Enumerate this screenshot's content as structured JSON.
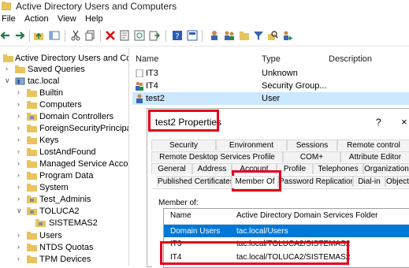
{
  "window": {
    "title": "Active Directory Users and Computers"
  },
  "menu": {
    "file": "File",
    "action": "Action",
    "view": "View",
    "help": "Help"
  },
  "tree": {
    "root": "Active Directory Users and Com",
    "saved_queries": "Saved Queries",
    "domain": "tac.local",
    "items": [
      "Builtin",
      "Computers",
      "Domain Controllers",
      "ForeignSecurityPrincipals",
      "Keys",
      "LostAndFound",
      "Managed Service Accour",
      "Program Data",
      "System",
      "Test_Adminis",
      "TOLUCA2"
    ],
    "sub_item": "SISTEMAS2",
    "after": [
      "Users",
      "NTDS Quotas",
      "TPM Devices"
    ]
  },
  "list": {
    "headers": {
      "name": "Name",
      "type": "Type",
      "description": "Description"
    },
    "rows": [
      {
        "name": "IT3",
        "type": "Unknown"
      },
      {
        "name": "IT4",
        "type": "Security Group..."
      },
      {
        "name": "test2",
        "type": "User"
      }
    ]
  },
  "dialog": {
    "title": "test2 Properties",
    "help": "?",
    "close": "×",
    "tabs_row1": [
      "Security",
      "Environment",
      "Sessions",
      "Remote control"
    ],
    "tabs_row2": [
      "Remote Desktop Services Profile",
      "COM+",
      "Attribute Editor"
    ],
    "tabs_row3": [
      "General",
      "Address",
      "Account",
      "Profile",
      "Telephones",
      "Organization"
    ],
    "tabs_row4": [
      "Published Certificates",
      "Member Of",
      "Password Replication",
      "Dial-in",
      "Object"
    ],
    "member_of_label": "Member of:",
    "columns": {
      "name": "Name",
      "folder": "Active Directory Domain Services Folder"
    },
    "rows": [
      {
        "name": "Domain Users",
        "folder": "tac.local/Users"
      },
      {
        "name": "IT3",
        "folder": "tac.local/TOLUCA2/SISTEMAS2"
      },
      {
        "name": "IT4",
        "folder": "tac.local/TOLUCA2/SISTEMAS2"
      }
    ]
  },
  "colors": {
    "highlight": "#e4001b",
    "selection": "#0078d7",
    "list_selection": "#cce8ff",
    "folder": "#e8c35e"
  }
}
